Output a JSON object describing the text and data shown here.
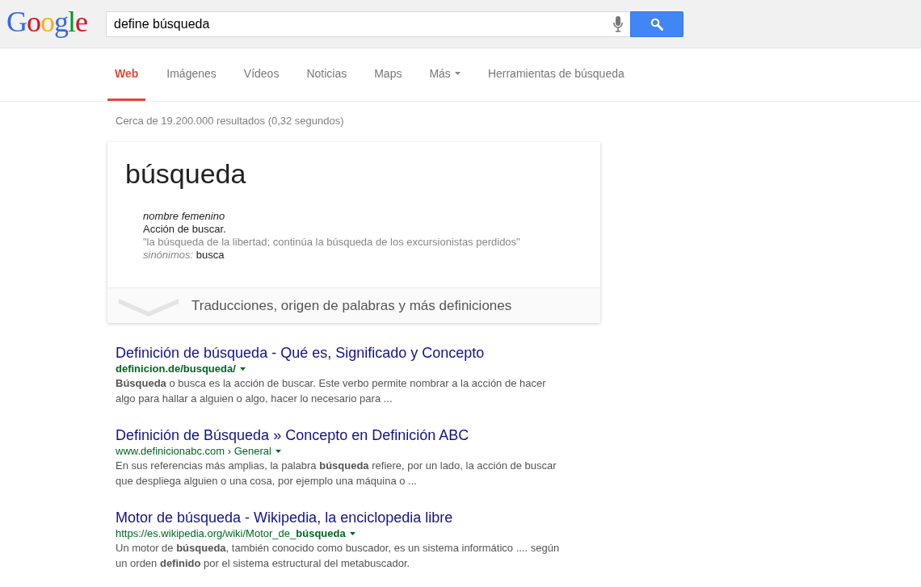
{
  "logo": "Google",
  "search": {
    "value": "define búsqueda"
  },
  "tabs": [
    {
      "label": "Web",
      "selected": true,
      "dropdown": false
    },
    {
      "label": "Imágenes",
      "selected": false,
      "dropdown": false
    },
    {
      "label": "Vídeos",
      "selected": false,
      "dropdown": false
    },
    {
      "label": "Noticias",
      "selected": false,
      "dropdown": false
    },
    {
      "label": "Maps",
      "selected": false,
      "dropdown": false
    },
    {
      "label": "Más",
      "selected": false,
      "dropdown": true
    },
    {
      "label": "Herramientas de búsqueda",
      "selected": false,
      "dropdown": false
    }
  ],
  "result_stats": "Cerca de 19.200.000 resultados (0,32 segundos)",
  "definition_card": {
    "word": "búsqueda",
    "part_of_speech": "nombre femenino",
    "definition": "Acción de buscar.",
    "example": "\"la búsqueda de la libertad; continúa la búsqueda de los excursionistas perdidos\"",
    "synonyms_label": "sinónimos:",
    "synonyms": [
      "busca"
    ],
    "more_link": "Traducciones, origen de palabras y más definiciones"
  },
  "results": [
    {
      "title": "Definición de búsqueda - Qué es, Significado y Concepto",
      "url": "**definicion.de/busqueda/**",
      "snippet": "**Búsqueda** o busca es la acción de buscar. Este verbo permite nombrar a la acción de hacer algo para hallar a alguien o algo, hacer lo necesario para ..."
    },
    {
      "title": "Definición de Búsqueda » Concepto en Definición ABC",
      "url": "www.definicionabc.com › General",
      "snippet": "En sus referencias más amplias, la palabra **búsqueda** refiere, por un lado, la acción de buscar que despliega alguien o una cosa, por ejemplo una máquina o ..."
    },
    {
      "title": "Motor de búsqueda - Wikipedia, la enciclopedia libre",
      "url": "https://es.wikipedia.org/wiki/Motor_de_**búsqueda**",
      "snippet": "Un motor de **búsqueda**, también conocido como buscador, es un sistema informático .... según un orden **definido** por el sistema estructural del metabuscador."
    }
  ]
}
